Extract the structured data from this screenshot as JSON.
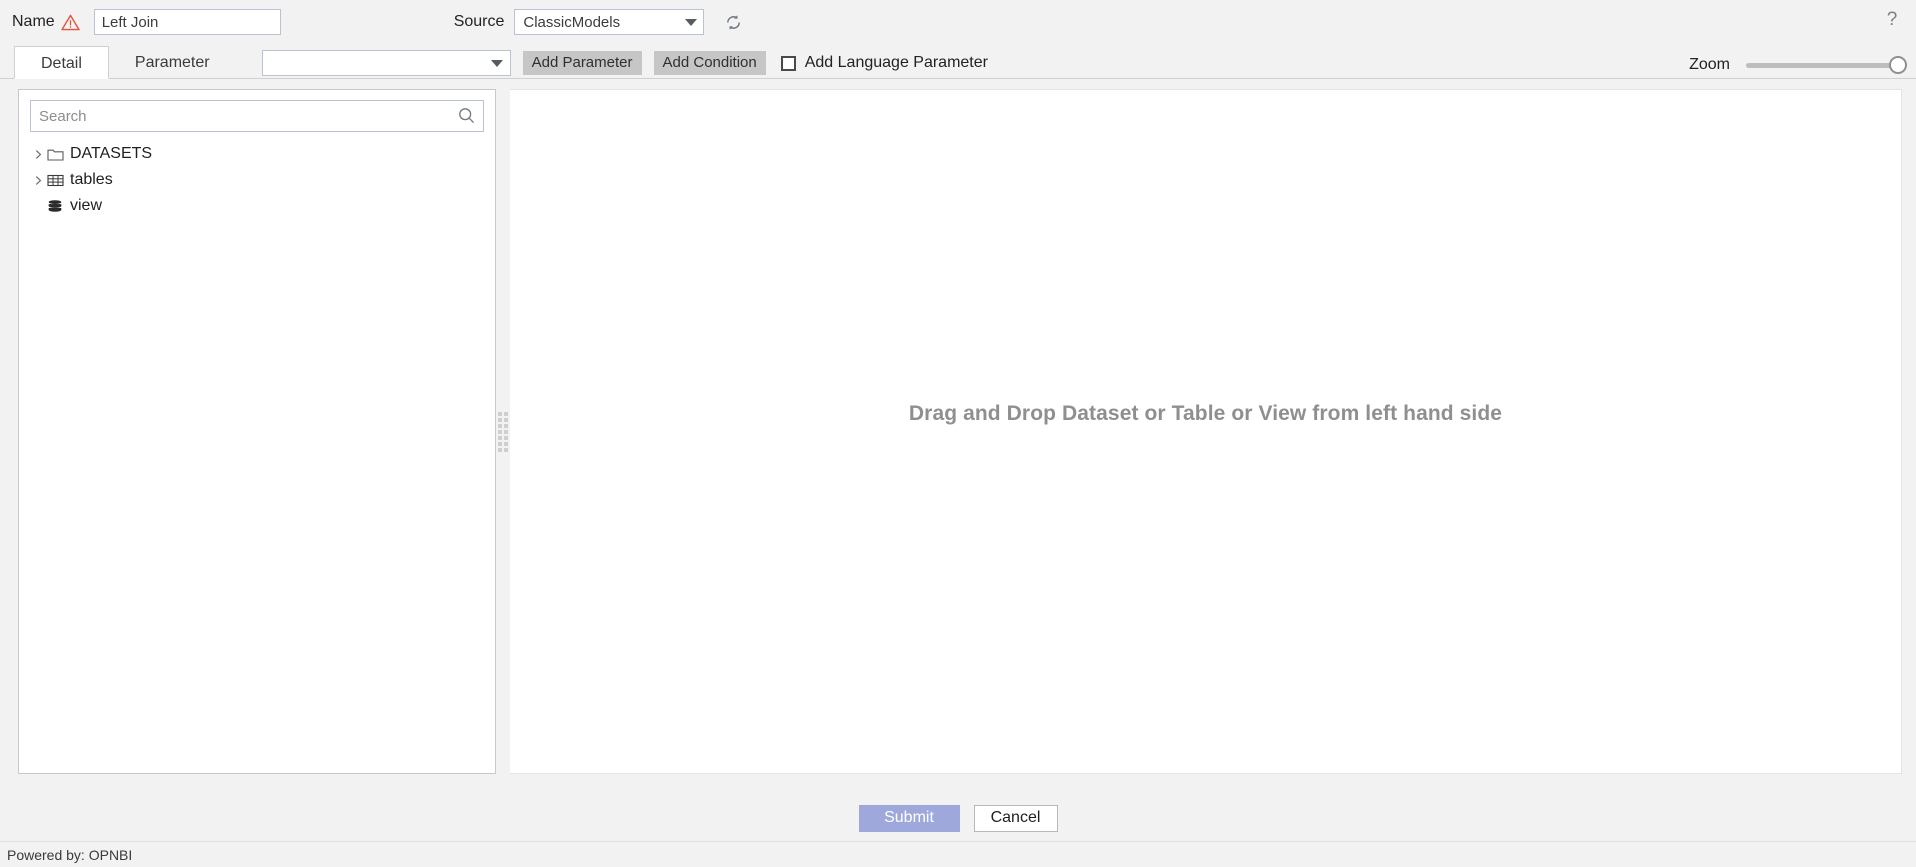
{
  "topbar": {
    "name_label": "Name",
    "warn_icon": "warning-triangle-icon",
    "name_value": "Left Join",
    "name_placeholder": "",
    "source_label": "Source",
    "source_value": "ClassicModels",
    "refresh_icon": "refresh-icon",
    "help_icon": "?"
  },
  "tabs": [
    {
      "label": "Detail",
      "active": true
    },
    {
      "label": "Parameter",
      "active": false
    }
  ],
  "toolbar": {
    "param_select_value": "",
    "add_parameter_label": "Add Parameter",
    "add_condition_label": "Add Condition",
    "add_language_parameter_label": "Add Language Parameter",
    "add_language_parameter_checked": false,
    "zoom_label": "Zoom",
    "zoom_value": 100
  },
  "left_panel": {
    "search_placeholder": "Search",
    "search_value": "",
    "search_icon": "search-icon",
    "tree": [
      {
        "label": "DATASETS",
        "icon": "folder-icon",
        "expandable": true,
        "expanded": false
      },
      {
        "label": "tables",
        "icon": "table-grid-icon",
        "expandable": true,
        "expanded": false
      },
      {
        "label": "view",
        "icon": "database-stack-icon",
        "expandable": false,
        "expanded": false
      }
    ]
  },
  "right_panel": {
    "drop_hint": "Drag and Drop Dataset or Table or View from left hand side"
  },
  "buttons": {
    "submit_label": "Submit",
    "cancel_label": "Cancel"
  },
  "footer": {
    "powered_by": "Powered by: OPNBI"
  },
  "colors": {
    "page_bg": "#f2f2f2",
    "panel_bg": "#ffffff",
    "accent_submit": "#9fa8da",
    "button_gray": "#c6c6c6",
    "warn_red": "#e8503a",
    "hint_gray": "#8f8f8f",
    "border": "#b9c3d1"
  }
}
